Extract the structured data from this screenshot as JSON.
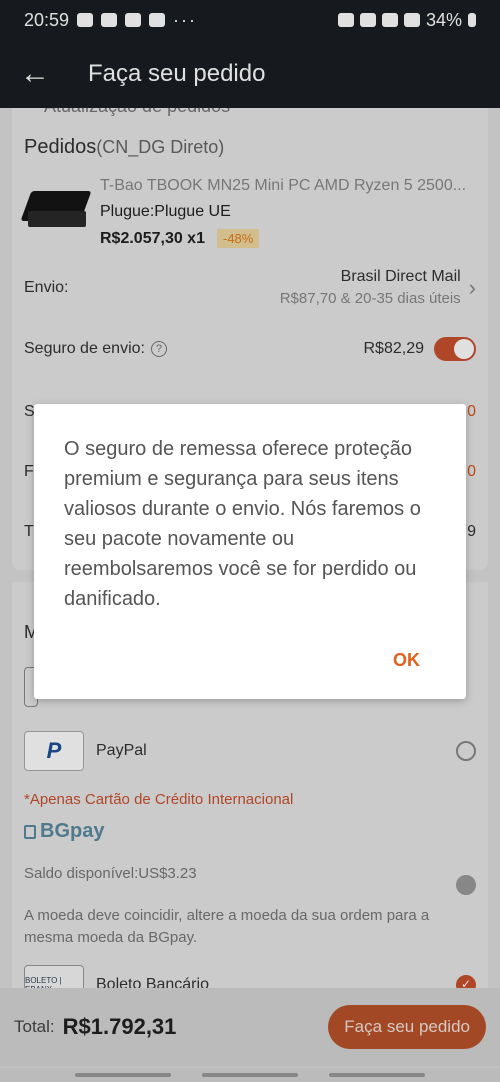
{
  "status": {
    "time": "20:59",
    "more": "···",
    "battery": "34%"
  },
  "appbar": {
    "back": "←",
    "title": "Faça seu pedido"
  },
  "orders": {
    "cut_header": "Atualização de pedidos",
    "title": "Pedidos",
    "subtitle": "(CN_DG Direto)",
    "product": {
      "name": "T-Bao TBOOK MN25 Mini PC AMD Ryzen 5 2500...",
      "plug": "Plugue:Plugue UE",
      "price": "R$2.057,30 x1",
      "discount": "-48%"
    },
    "shipping": {
      "label": "Envio:",
      "method": "Brasil Direct Mail",
      "detail": "R$87,70 & 20-35 dias úteis"
    },
    "insurance": {
      "label": "Seguro de envio:",
      "help": "?",
      "price": "R$82,29",
      "enabled": true
    },
    "hidden_rows": [
      {
        "start": "S",
        "end": "0"
      },
      {
        "start": "F",
        "end": "0"
      },
      {
        "start": "T",
        "end": "9"
      }
    ]
  },
  "payment": {
    "header_letter": "M",
    "paypal_logo": "P",
    "paypal_label": "PayPal",
    "credit_note": "*Apenas Cartão de Crédito  Internacional",
    "bgpay_logo": "BGpay",
    "bgpay_balance": "Saldo disponível:US$3.23",
    "bgpay_note": "A moeda deve coincidir, altere a moeda da sua ordem para a mesma moeda da BGpay.",
    "boleto_logo": "BOLETO | EBANX",
    "boleto_label": "Boleto Bancário"
  },
  "footer": {
    "total_label": "Total:",
    "total_value": "R$1.792,31",
    "order_button": "Faça seu pedido"
  },
  "dialog": {
    "message": "O seguro de remessa oferece proteção premium e segurança para seus itens valiosos durante o envio. Nós faremos o seu pacote novamente ou reembolsaremos você se for perdido ou danificado.",
    "ok": "OK"
  },
  "colors": {
    "accent": "#e2601b",
    "dark_bar": "#1a1d21"
  }
}
